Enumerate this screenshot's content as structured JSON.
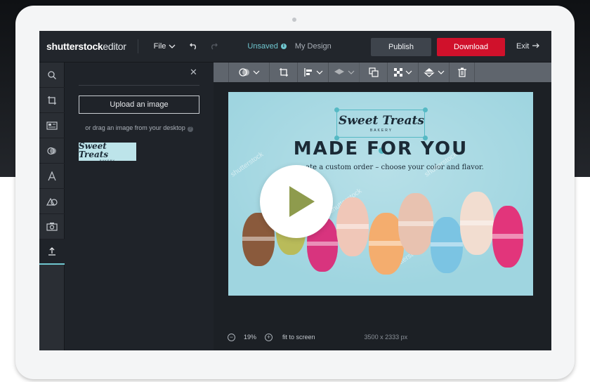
{
  "colors": {
    "accent": "#6fc6cf",
    "download": "#d0112b",
    "publish": "#3e444c",
    "canvas_bg": "#9fd5e0"
  },
  "header": {
    "logo_bold": "shutterstock",
    "logo_light": "editor",
    "file_label": "File",
    "undo_icon": "undo-icon",
    "redo_icon": "redo-icon",
    "status": "Unsaved",
    "design_name": "My Design",
    "publish_label": "Publish",
    "download_label": "Download",
    "exit_label": "Exit"
  },
  "rail": {
    "items": [
      "search-icon",
      "crop-icon",
      "text-box-icon",
      "filter-icon",
      "text-icon",
      "shapes-icon",
      "photo-icon",
      "upload-icon"
    ],
    "active_index": 7
  },
  "panel": {
    "upload_label": "Upload an image",
    "drag_text": "or drag an image from your desktop",
    "thumb_title": "Sweet Treats",
    "thumb_sub": "BAKERY"
  },
  "toolbar": {
    "tools": [
      "opacity-icon",
      "crop-icon",
      "align-icon",
      "layers-icon",
      "duplicate-icon",
      "transparency-icon",
      "flip-icon",
      "trash-icon"
    ]
  },
  "canvas": {
    "logo_title": "Sweet Treats",
    "logo_sub": "BAKERY",
    "headline": "MADE FOR YOU",
    "subline": "ate a custom order – choose your color and flavor.",
    "watermark": "shutterstock"
  },
  "bottombar": {
    "zoom": "19%",
    "fit_label": "fit to screen",
    "dimensions": "3500 x 2333 px"
  }
}
